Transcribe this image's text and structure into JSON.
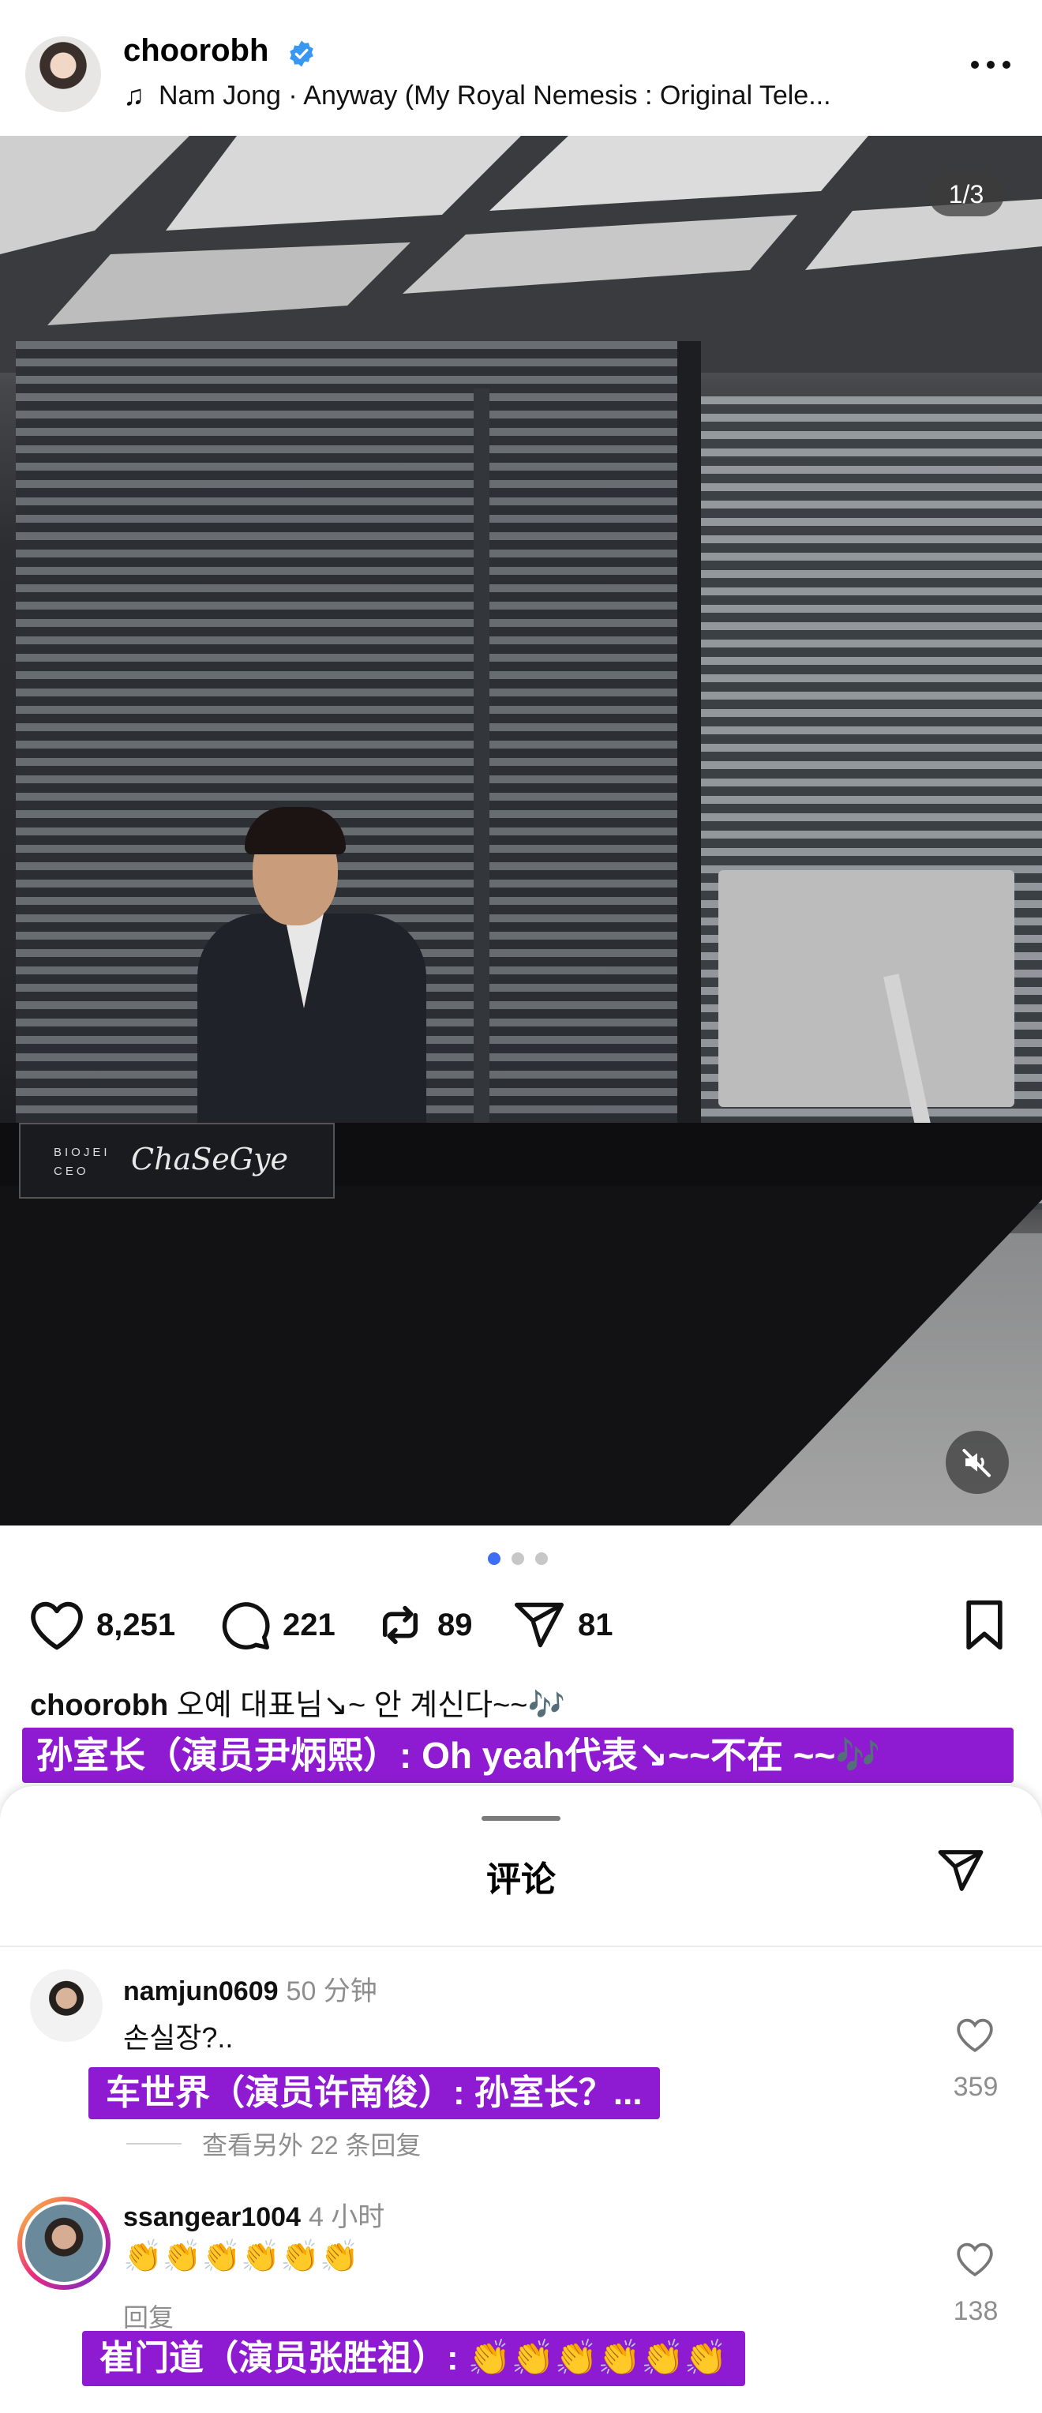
{
  "header": {
    "username": "choorobh",
    "music": "Nam Jong · Anyway (My Royal Nemesis : Original Tele..."
  },
  "media": {
    "counter": "1/3",
    "nameplate_company": "BIOJEI",
    "nameplate_role": "CEO",
    "nameplate_signature": "ChaSeGye",
    "carousel_total": 3,
    "carousel_active": 1
  },
  "actions": {
    "likes": "8,251",
    "comments": "221",
    "reposts": "89",
    "shares": "81"
  },
  "caption": {
    "username": "choorobh",
    "text": "오예 대표님↘~ 안 계신다~~🎶"
  },
  "subtitles": {
    "caption": "孙室长（演员尹炳熙）: Oh yeah代表↘~~不在 ~~🎶",
    "comment1": "车世界（演员许南俊）: 孙室长？...",
    "comment2": "崔门道（演员张胜祖）: 👏👏👏👏👏👏"
  },
  "sheet": {
    "title": "评论"
  },
  "comments": [
    {
      "username": "namjun0609",
      "time": "50 分钟",
      "text": "손실장?..",
      "likes": "359",
      "replies": "查看另外 22 条回复"
    },
    {
      "username": "ssangear1004",
      "time": "4 小时",
      "text": "👏👏👏👏👏👏",
      "likes": "138",
      "reply": "回复"
    }
  ],
  "colors": {
    "verified": "#3897f0",
    "subtitle_bg": "#8e1bd1",
    "carousel_active": "#3d6df2"
  }
}
